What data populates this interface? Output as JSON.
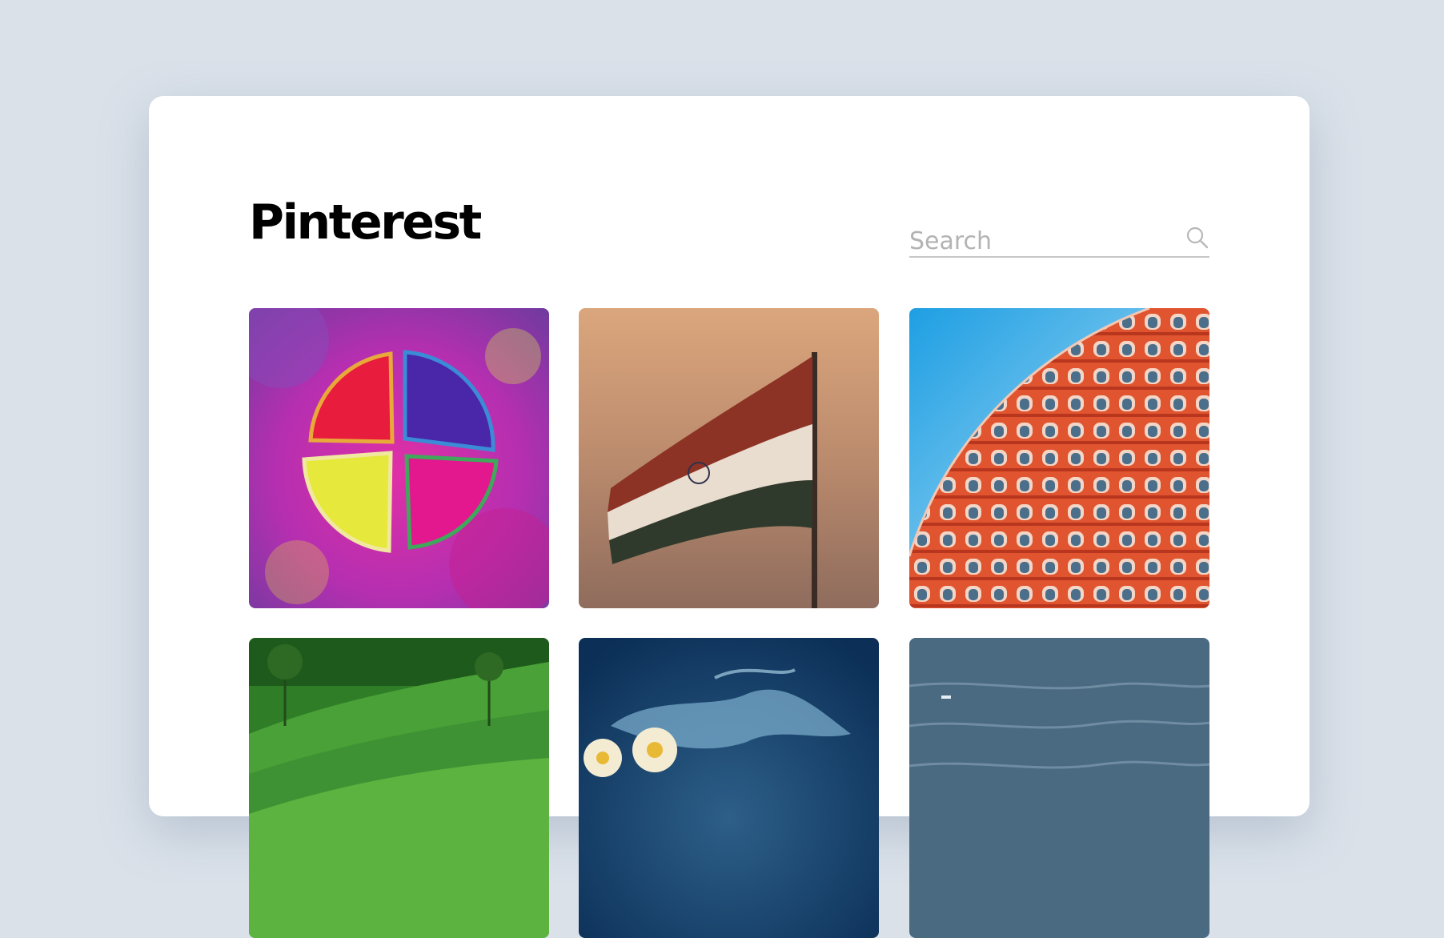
{
  "header": {
    "title": "Pinterest"
  },
  "search": {
    "placeholder": "Search",
    "icon": "search-icon"
  },
  "pins": [
    {
      "subject": "holi-color-powder"
    },
    {
      "subject": "indian-flag-at-sunset"
    },
    {
      "subject": "hawa-mahal-facade"
    },
    {
      "subject": "tea-plantation"
    },
    {
      "subject": "flowers-in-water"
    },
    {
      "subject": "sea-water"
    }
  ],
  "colors": {
    "background": "#dae1e9",
    "card": "#ffffff",
    "title": "#000000",
    "search_placeholder": "#b3b3b3",
    "search_underline": "#c7c7c7"
  }
}
